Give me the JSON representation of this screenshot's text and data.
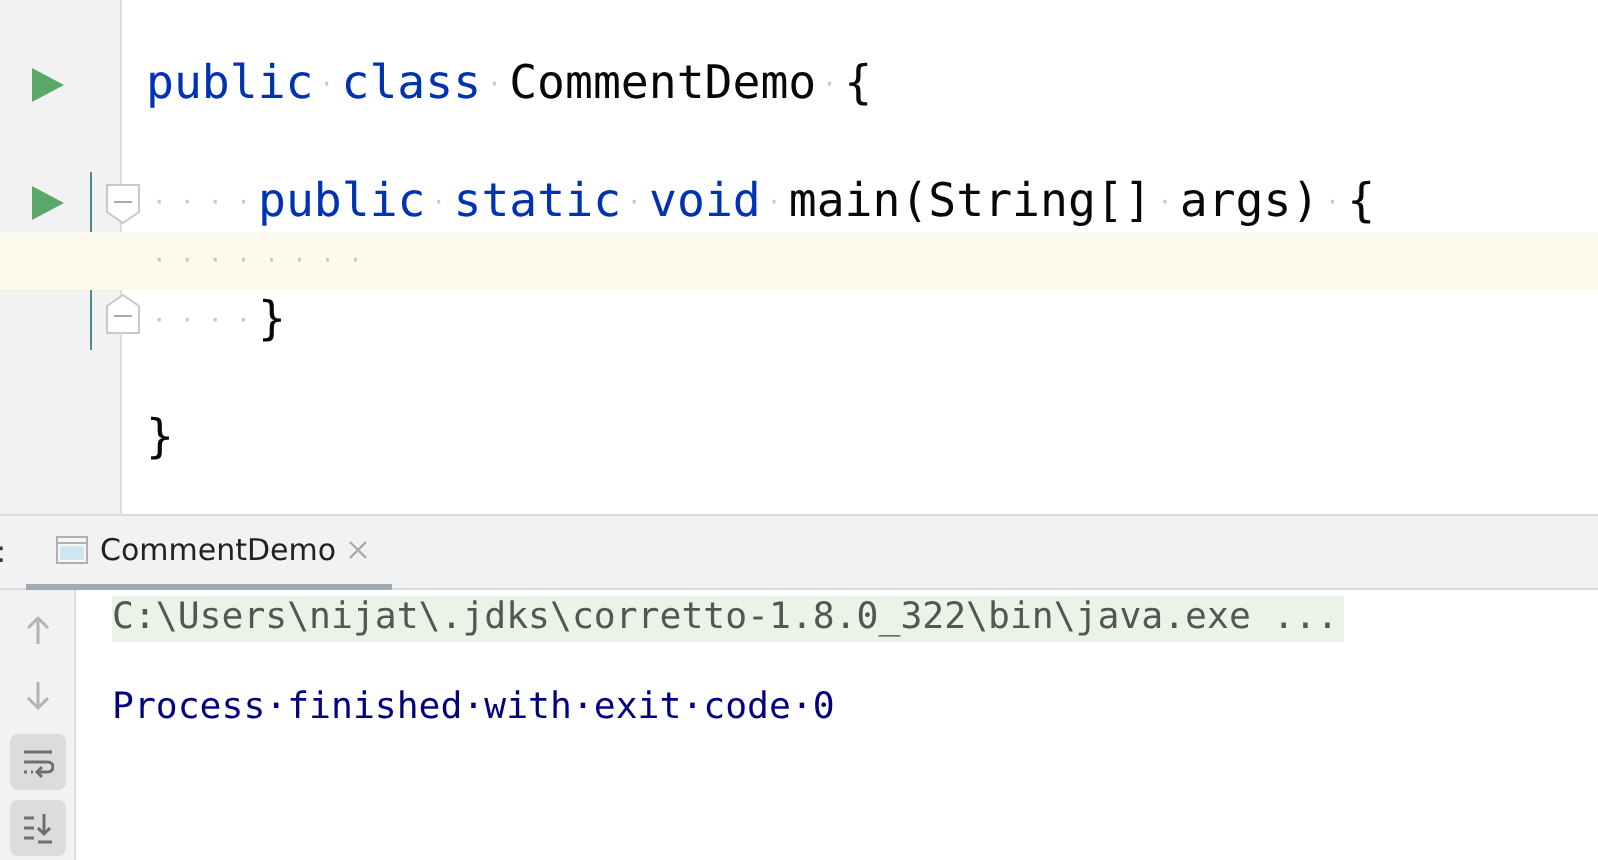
{
  "editor": {
    "lines": [
      {
        "run": true,
        "kind": "code",
        "current": false,
        "tokens": [
          {
            "kind": "keyword",
            "text": "public"
          },
          {
            "kind": "space",
            "text": "·"
          },
          {
            "kind": "keyword",
            "text": "class"
          },
          {
            "kind": "space",
            "text": "·"
          },
          {
            "kind": "plain",
            "text": "CommentDemo"
          },
          {
            "kind": "space",
            "text": "·"
          },
          {
            "kind": "plain",
            "text": "{"
          }
        ]
      },
      {
        "run": false,
        "kind": "code",
        "current": false
      },
      {
        "run": true,
        "kind": "fold-start",
        "current": false,
        "tokens": [
          {
            "kind": "space",
            "text": "····"
          },
          {
            "kind": "keyword",
            "text": "public"
          },
          {
            "kind": "space",
            "text": "·"
          },
          {
            "kind": "keyword",
            "text": "static"
          },
          {
            "kind": "space",
            "text": "·"
          },
          {
            "kind": "keyword",
            "text": "void"
          },
          {
            "kind": "space",
            "text": "·"
          },
          {
            "kind": "plain",
            "text": "main(String[]"
          },
          {
            "kind": "space",
            "text": "·"
          },
          {
            "kind": "plain",
            "text": "args)"
          },
          {
            "kind": "space",
            "text": "·"
          },
          {
            "kind": "plain",
            "text": "{"
          }
        ]
      },
      {
        "run": false,
        "kind": "code",
        "current": true,
        "tokens": [
          {
            "kind": "space",
            "text": "········"
          }
        ]
      },
      {
        "run": false,
        "kind": "fold-end",
        "current": false,
        "tokens": [
          {
            "kind": "space",
            "text": "····"
          },
          {
            "kind": "plain",
            "text": "}"
          }
        ]
      },
      {
        "run": false,
        "kind": "code",
        "current": false
      },
      {
        "run": false,
        "kind": "code",
        "current": false,
        "tokens": [
          {
            "kind": "plain",
            "text": "}"
          }
        ]
      }
    ]
  },
  "run_panel": {
    "label": ":",
    "tabs": [
      {
        "label": "CommentDemo",
        "selected": true
      }
    ],
    "toolbar": [
      {
        "kind": "up",
        "disabled": true,
        "on": false
      },
      {
        "kind": "down",
        "disabled": true,
        "on": false
      },
      {
        "kind": "wrap",
        "disabled": false,
        "on": true
      },
      {
        "kind": "scroll-end",
        "disabled": false,
        "on": true
      }
    ],
    "console": [
      {
        "kind": "command",
        "text": "C:\\Users\\nijat\\.jdks\\corretto-1.8.0_322\\bin\\java.exe ..."
      },
      {
        "kind": "blank"
      },
      {
        "kind": "system",
        "text": "Process·finished·with·exit·code·0"
      }
    ]
  }
}
